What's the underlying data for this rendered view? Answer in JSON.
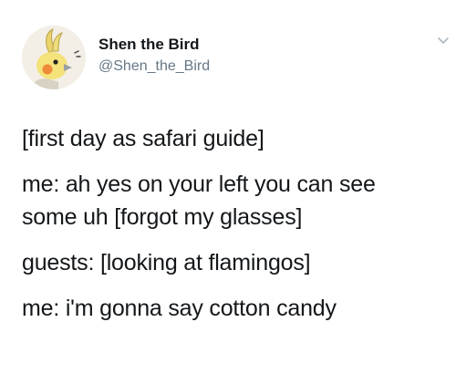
{
  "author": {
    "display_name": "Shen the Bird",
    "handle": "@Shen_the_Bird",
    "avatar_icon": "cockatiel-avatar-icon"
  },
  "menu": {
    "icon": "chevron-down-icon"
  },
  "tweet": {
    "lines": [
      "[first day as safari guide]",
      "me: ah yes on your left you can see",
      "some uh [forgot my glasses]",
      "guests: [looking at flamingos]",
      "me: i'm gonna say cotton candy"
    ]
  },
  "colors": {
    "text": "#14171a",
    "secondary_text": "#657786",
    "background": "#ffffff"
  }
}
